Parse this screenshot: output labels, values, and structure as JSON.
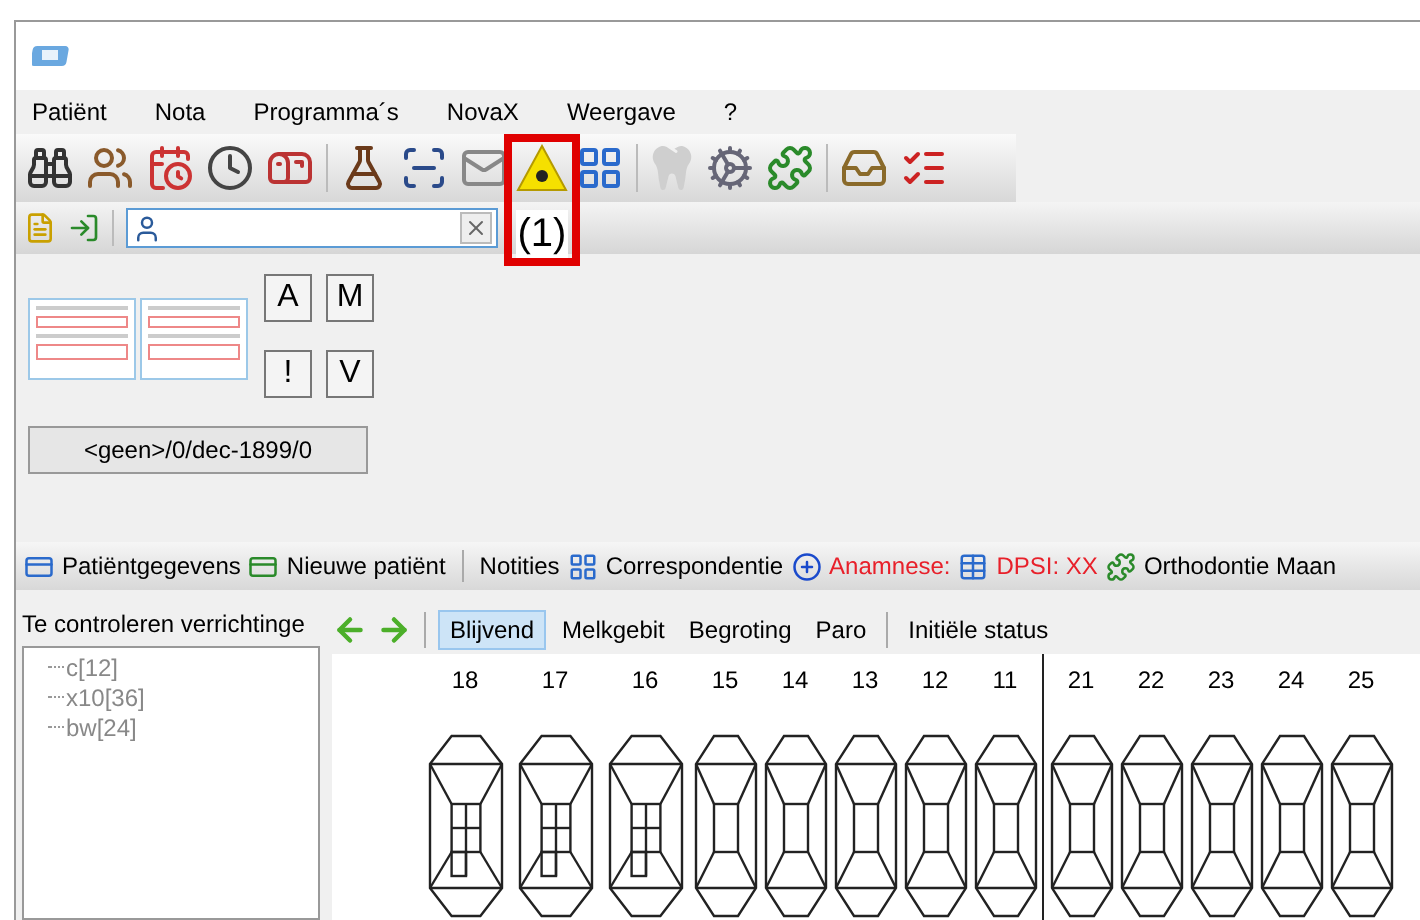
{
  "menu": [
    {
      "label": "Patiënt"
    },
    {
      "label": "Nota"
    },
    {
      "label": "Programma´s"
    },
    {
      "label": "NovaX"
    },
    {
      "label": "Weergave"
    },
    {
      "label": "?"
    }
  ],
  "toolbar": {
    "annotation": "(1)"
  },
  "patient_summary": {
    "buttons": [
      "A",
      "M",
      "!",
      "V"
    ],
    "date_button": "<geen>/0/dec-1899/0"
  },
  "patient_toolbar": [
    {
      "label": "Patiëntgegevens",
      "warning": false
    },
    {
      "label": "Nieuwe patiënt",
      "warning": false,
      "separator_after": true
    },
    {
      "label": "Notities",
      "warning": false
    },
    {
      "label": "Correspondentie",
      "warning": false
    },
    {
      "label": "Anamnese:",
      "warning": true
    },
    {
      "label": "DPSI: XX",
      "warning": true
    },
    {
      "label": "Orthodontie Maan",
      "warning": false
    }
  ],
  "checks_panel": {
    "title": "Te controleren verrichtinge",
    "items": [
      {
        "label": "c[12]"
      },
      {
        "label": "x10[36]"
      },
      {
        "label": "bw[24]"
      }
    ]
  },
  "tabs": [
    {
      "label": "Blijvend",
      "selected": true
    },
    {
      "label": "Melkgebit",
      "selected": false
    },
    {
      "label": "Begroting",
      "selected": false
    },
    {
      "label": "Paro",
      "selected": false
    },
    {
      "label": "Initiële status",
      "selected": false,
      "separated": true
    }
  ],
  "teeth": [
    {
      "number": "18",
      "kind": "molar"
    },
    {
      "number": "17",
      "kind": "molar"
    },
    {
      "number": "16",
      "kind": "molar"
    },
    {
      "number": "15",
      "kind": "front"
    },
    {
      "number": "14",
      "kind": "front"
    },
    {
      "number": "13",
      "kind": "front"
    },
    {
      "number": "12",
      "kind": "front"
    },
    {
      "number": "11",
      "kind": "front",
      "midline_after": true
    },
    {
      "number": "21",
      "kind": "front"
    },
    {
      "number": "22",
      "kind": "front"
    },
    {
      "number": "23",
      "kind": "front"
    },
    {
      "number": "24",
      "kind": "front"
    },
    {
      "number": "25",
      "kind": "front"
    }
  ]
}
